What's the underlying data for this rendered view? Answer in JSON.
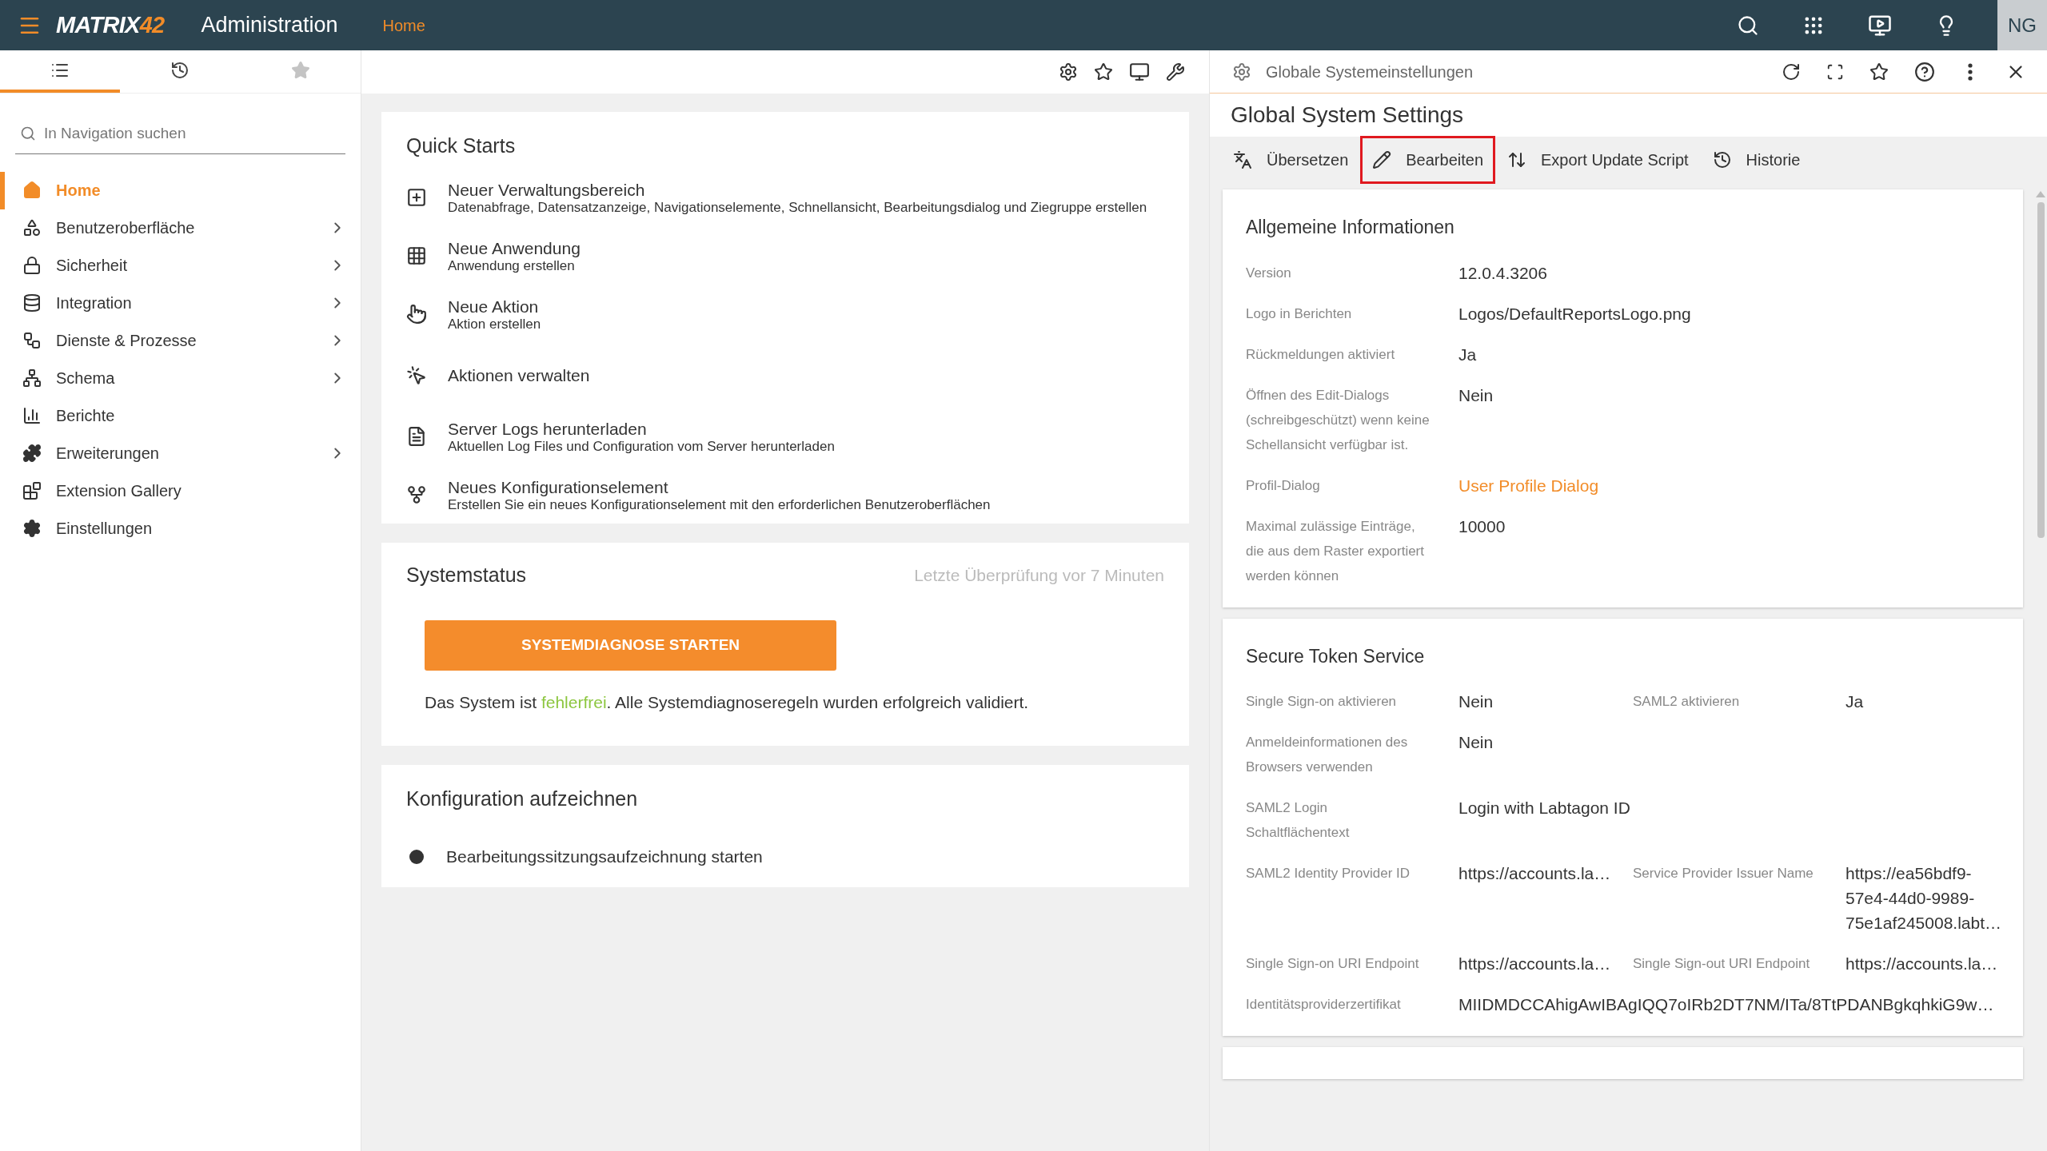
{
  "top_bar": {
    "logo": {
      "text": "MATRIX",
      "accent": "42"
    },
    "title": "Administration",
    "breadcrumb": "Home",
    "avatar": "NG"
  },
  "sidebar": {
    "tabs": [
      {
        "selected": true,
        "disabled": false
      },
      {
        "selected": false,
        "disabled": false
      },
      {
        "selected": false,
        "disabled": true
      }
    ],
    "search": {
      "placeholder": "In Navigation suchen"
    },
    "items": [
      {
        "label": "Home",
        "selected": true,
        "expandable": false
      },
      {
        "label": "Benutzeroberfläche",
        "selected": false,
        "expandable": true
      },
      {
        "label": "Sicherheit",
        "selected": false,
        "expandable": true
      },
      {
        "label": "Integration",
        "selected": false,
        "expandable": true
      },
      {
        "label": "Dienste & Prozesse",
        "selected": false,
        "expandable": true
      },
      {
        "label": "Schema",
        "selected": false,
        "expandable": true
      },
      {
        "label": "Berichte",
        "selected": false,
        "expandable": false
      },
      {
        "label": "Erweiterungen",
        "selected": false,
        "expandable": true
      },
      {
        "label": "Extension Gallery",
        "selected": false,
        "expandable": false
      },
      {
        "label": "Einstellungen",
        "selected": false,
        "expandable": false
      }
    ]
  },
  "quick_starts": {
    "title": "Quick Starts",
    "items": [
      {
        "title": "Neuer Verwaltungsbereich",
        "subtitle": "Datenabfrage, Datensatzanzeige, Navigationselemente, Schnellansicht, Bearbeitungsdialog und Ziegruppe erstellen"
      },
      {
        "title": "Neue Anwendung",
        "subtitle": "Anwendung erstellen"
      },
      {
        "title": "Neue Aktion",
        "subtitle": "Aktion erstellen"
      },
      {
        "title": "Aktionen verwalten"
      },
      {
        "title": "Server Logs herunterladen",
        "subtitle": "Aktuellen Log Files und Configuration vom Server herunterladen"
      },
      {
        "title": "Neues Konfigurationselement",
        "subtitle": "Erstellen Sie ein neues Konfigurationselement mit den erforderlichen Benutzeroberflächen"
      }
    ]
  },
  "system_status": {
    "title": "Systemstatus",
    "last_check": "Letzte Überprüfung vor 7 Minuten",
    "button": "SYSTEMDIAGNOSE STARTEN",
    "message": {
      "before": "Das System ist ",
      "highlight": "fehlerfrei",
      "after": ". Alle Systemdiagnoseregeln wurden erfolgreich validiert."
    }
  },
  "record_config": {
    "title": "Konfiguration aufzeichnen",
    "action": "Bearbeitungssitzungsaufzeichnung starten"
  },
  "detail_panel": {
    "header": "Globale Systemeinstellungen",
    "title": "Global System Settings",
    "actions": [
      {
        "label": "Übersetzen",
        "highlighted": false
      },
      {
        "label": "Bearbeiten",
        "highlighted": true
      },
      {
        "label": "Export Update Script",
        "highlighted": false
      },
      {
        "label": "Historie",
        "highlighted": false
      }
    ],
    "sections": [
      {
        "title": "Allgemeine Informationen",
        "rows": [
          [
            {
              "label": "Version",
              "value": "12.0.4.3206",
              "kind": "text"
            }
          ],
          [
            {
              "label": "Logo in Berichten",
              "value": "Logos/DefaultReportsLogo.png",
              "kind": "text"
            }
          ],
          [
            {
              "label": "Rückmeldungen aktiviert",
              "value": "Ja",
              "kind": "text"
            }
          ],
          [
            {
              "label": "Öffnen des Edit-Dialogs (schreibgeschützt) wenn keine Schellansicht verfügbar ist.",
              "value": "Nein",
              "kind": "text"
            }
          ],
          [
            {
              "label": "Profil-Dialog",
              "value": "User Profile Dialog",
              "kind": "link"
            }
          ],
          [
            {
              "label": "Maximal zulässige Einträge, die aus dem Raster exportiert werden können",
              "value": "10000",
              "kind": "text"
            }
          ]
        ]
      },
      {
        "title": "Secure Token Service",
        "rows": [
          [
            {
              "label": "Single Sign-on aktivieren",
              "value": "Nein",
              "kind": "text"
            },
            {
              "label": "SAML2 aktivieren",
              "value": "Ja",
              "kind": "text"
            }
          ],
          [
            {
              "label": "Anmeldeinformationen des Browsers verwenden",
              "value": "Nein",
              "kind": "text"
            }
          ],
          [
            {
              "label": "SAML2 Login Schaltflächentext",
              "value": "Login with Labtagon ID",
              "kind": "text"
            }
          ],
          [
            {
              "label": "SAML2 Identity Provider ID",
              "value": "https://accounts.la…",
              "kind": "text"
            },
            {
              "label": "Service Provider Issuer Name",
              "value": "https://ea56bdf9-57e4-44d0-9989-75e1af245008.labt…",
              "kind": "text"
            }
          ],
          [
            {
              "label": "Single Sign-on URI Endpoint",
              "value": "https://accounts.la…",
              "kind": "text"
            },
            {
              "label": "Single Sign-out URI Endpoint",
              "value": "https://accounts.la…",
              "kind": "text"
            }
          ],
          [
            {
              "label": "Identitätsproviderzertifikat",
              "value": "MIIDMDCCAhigAwIBAgIQQ7oIRb2DT7NM/ITa/8TtPDANBgkqhkiG9w…",
              "kind": "text"
            }
          ]
        ]
      }
    ]
  }
}
